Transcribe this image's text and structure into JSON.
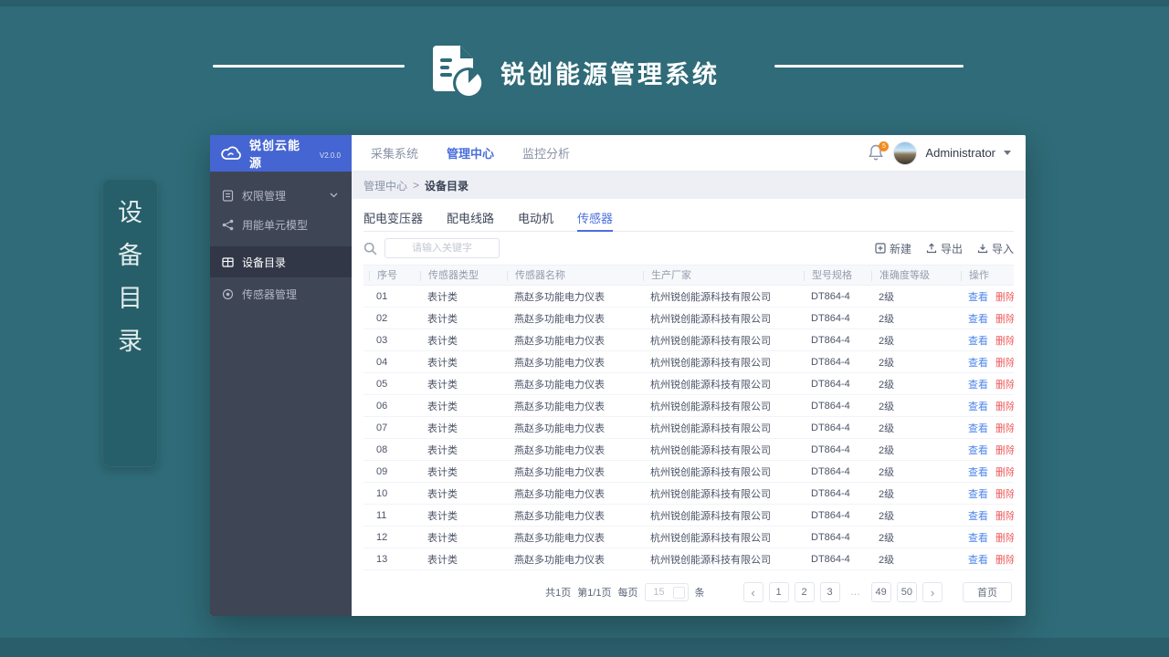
{
  "banner": {
    "title": "锐创能源管理系统"
  },
  "side_card": {
    "chars": [
      "设",
      "备",
      "目",
      "录"
    ]
  },
  "sidebar": {
    "logo_text": "锐创云能源",
    "logo_version": "V2.0.0",
    "items": [
      {
        "label": "权限管理"
      },
      {
        "label": "用能单元模型"
      },
      {
        "label": "设备目录"
      },
      {
        "label": "传感器管理"
      }
    ]
  },
  "topnav": {
    "items": [
      {
        "label": "采集系统"
      },
      {
        "label": "管理中心"
      },
      {
        "label": "监控分析"
      }
    ],
    "notification_count": "5",
    "user_name": "Administrator"
  },
  "breadcrumb": {
    "parent": "管理中心",
    "separator": ">",
    "current": "设备目录"
  },
  "tabs": [
    {
      "label": "配电变压器"
    },
    {
      "label": "配电线路"
    },
    {
      "label": "电动机"
    },
    {
      "label": "传感器"
    }
  ],
  "toolbar": {
    "search_placeholder": "请输入关键字",
    "new_label": "新建",
    "export_label": "导出",
    "import_label": "导入"
  },
  "table": {
    "columns": [
      "序号",
      "传感器类型",
      "传感器名称",
      "生产厂家",
      "型号规格",
      "准确度等级",
      "操作"
    ],
    "action_view": "查看",
    "action_delete": "删除",
    "rows": [
      {
        "seq": "01",
        "type": "表计类",
        "name": "燕赵多功能电力仪表",
        "manufacturer": "杭州锐创能源科技有限公司",
        "model": "DT864-4",
        "accuracy": "2级"
      },
      {
        "seq": "02",
        "type": "表计类",
        "name": "燕赵多功能电力仪表",
        "manufacturer": "杭州锐创能源科技有限公司",
        "model": "DT864-4",
        "accuracy": "2级"
      },
      {
        "seq": "03",
        "type": "表计类",
        "name": "燕赵多功能电力仪表",
        "manufacturer": "杭州锐创能源科技有限公司",
        "model": "DT864-4",
        "accuracy": "2级"
      },
      {
        "seq": "04",
        "type": "表计类",
        "name": "燕赵多功能电力仪表",
        "manufacturer": "杭州锐创能源科技有限公司",
        "model": "DT864-4",
        "accuracy": "2级"
      },
      {
        "seq": "05",
        "type": "表计类",
        "name": "燕赵多功能电力仪表",
        "manufacturer": "杭州锐创能源科技有限公司",
        "model": "DT864-4",
        "accuracy": "2级"
      },
      {
        "seq": "06",
        "type": "表计类",
        "name": "燕赵多功能电力仪表",
        "manufacturer": "杭州锐创能源科技有限公司",
        "model": "DT864-4",
        "accuracy": "2级"
      },
      {
        "seq": "07",
        "type": "表计类",
        "name": "燕赵多功能电力仪表",
        "manufacturer": "杭州锐创能源科技有限公司",
        "model": "DT864-4",
        "accuracy": "2级"
      },
      {
        "seq": "08",
        "type": "表计类",
        "name": "燕赵多功能电力仪表",
        "manufacturer": "杭州锐创能源科技有限公司",
        "model": "DT864-4",
        "accuracy": "2级"
      },
      {
        "seq": "09",
        "type": "表计类",
        "name": "燕赵多功能电力仪表",
        "manufacturer": "杭州锐创能源科技有限公司",
        "model": "DT864-4",
        "accuracy": "2级"
      },
      {
        "seq": "10",
        "type": "表计类",
        "name": "燕赵多功能电力仪表",
        "manufacturer": "杭州锐创能源科技有限公司",
        "model": "DT864-4",
        "accuracy": "2级"
      },
      {
        "seq": "11",
        "type": "表计类",
        "name": "燕赵多功能电力仪表",
        "manufacturer": "杭州锐创能源科技有限公司",
        "model": "DT864-4",
        "accuracy": "2级"
      },
      {
        "seq": "12",
        "type": "表计类",
        "name": "燕赵多功能电力仪表",
        "manufacturer": "杭州锐创能源科技有限公司",
        "model": "DT864-4",
        "accuracy": "2级"
      },
      {
        "seq": "13",
        "type": "表计类",
        "name": "燕赵多功能电力仪表",
        "manufacturer": "杭州锐创能源科技有限公司",
        "model": "DT864-4",
        "accuracy": "2级"
      }
    ]
  },
  "pagination": {
    "total_text": "共1页",
    "page_text": "第1/1页",
    "per_page_label": "每页",
    "per_page_value": "15",
    "unit_label": "条",
    "prev_icon": "‹",
    "next_icon": "›",
    "pages": [
      "1",
      "2",
      "3",
      "…",
      "49",
      "50"
    ],
    "first_label": "首页"
  },
  "colors": {
    "accent": "#4a6fdc",
    "view_link": "#4f86ec",
    "delete_link": "#ef5a5a",
    "badge": "#f08c1e",
    "background": "#2f6b78"
  }
}
